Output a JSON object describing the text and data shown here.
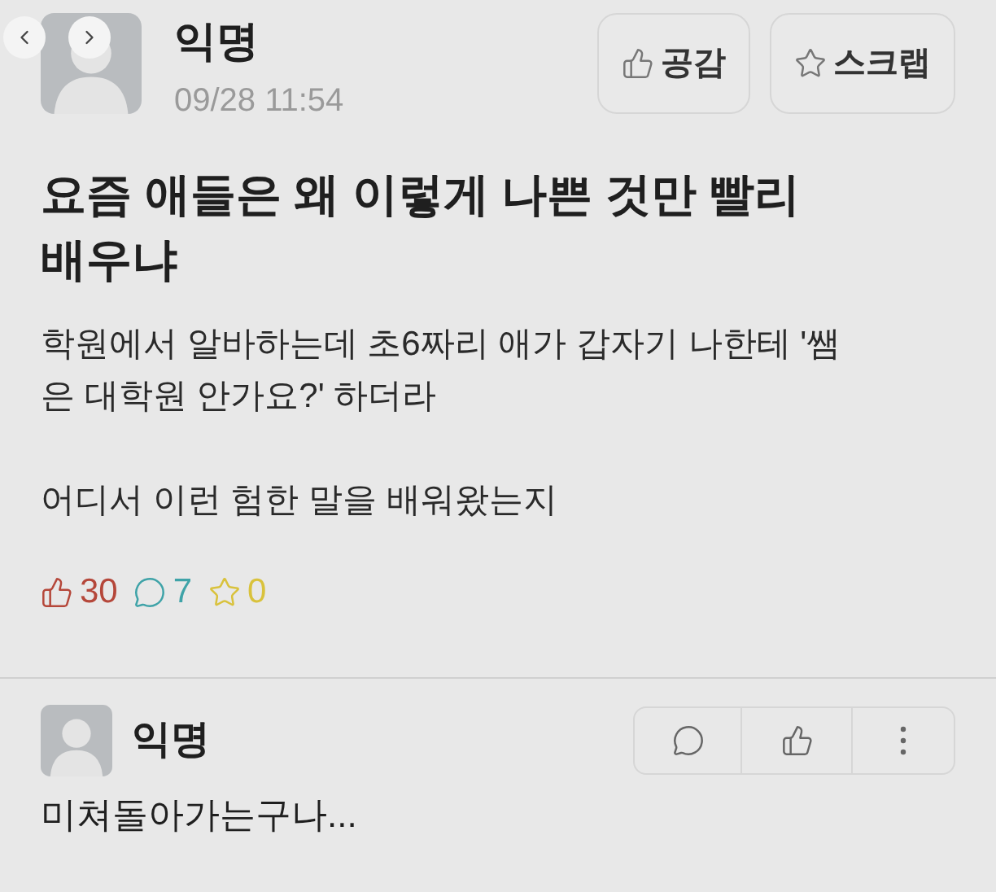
{
  "post": {
    "author": "익명",
    "time": "09/28 11:54",
    "actions": [
      {
        "kind": "like",
        "label": "공감"
      },
      {
        "kind": "scrap",
        "label": "스크랩"
      }
    ],
    "title": "요즘 애들은 왜 이렇게 나쁜 것만 빨리 배우냐",
    "paragraphs": [
      "학원에서 알바하는데 초6짜리 애가 갑자기 나한테 '쌤은 대학원 안가요?' 하더라",
      "어디서 이런 험한 말을 배워왔는지"
    ],
    "stats": [
      {
        "kind": "like",
        "value": "30",
        "color": "#b5473a"
      },
      {
        "kind": "comment",
        "value": "7",
        "color": "#3fa3a8"
      },
      {
        "kind": "scrap",
        "value": "0",
        "color": "#d9c23c"
      }
    ]
  },
  "comments": [
    {
      "author": "익명",
      "text": "미쳐돌아가는구나..."
    }
  ]
}
